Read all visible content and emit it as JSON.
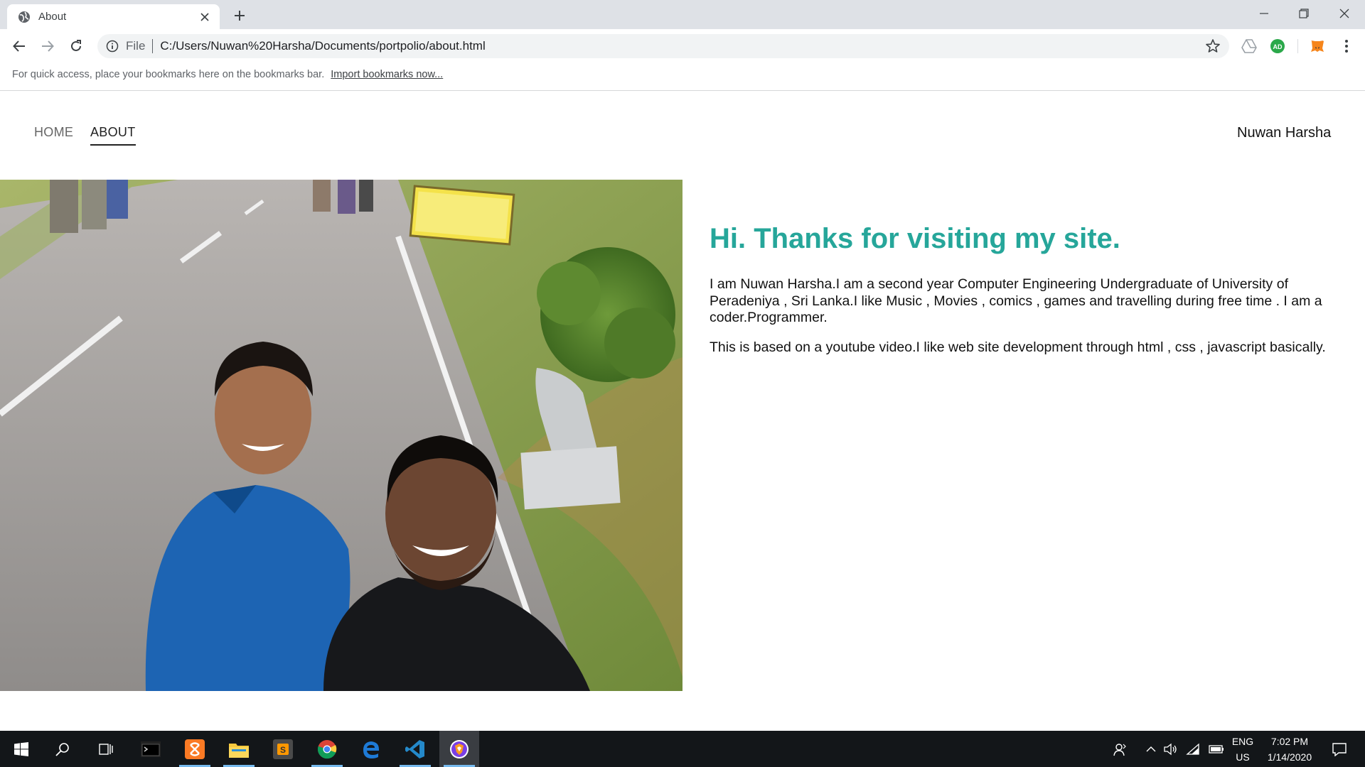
{
  "browser": {
    "tab_title": "About",
    "address": {
      "scheme_label": "File",
      "url": "C:/Users/Nuwan%20Harsha/Documents/portpolio/about.html"
    },
    "extensions": [
      "AD"
    ],
    "bookmarks_bar": {
      "message": "For quick access, place your bookmarks here on the bookmarks bar.",
      "link": "Import bookmarks now..."
    }
  },
  "page": {
    "nav": {
      "items": [
        "HOME",
        "ABOUT"
      ],
      "active": "ABOUT",
      "brand": "Nuwan Harsha"
    },
    "headline": "Hi. Thanks for visiting my site.",
    "paragraphs": [
      "I am Nuwan Harsha.I am a second year Computer Engineering Undergraduate of University of Peradeniya , Sri Lanka.I like Music , Movies , comics , games and travelling during free time . I am a coder.Programmer.",
      "This is based on a youtube video.I like web site development through html , css , javascript basically."
    ],
    "colors": {
      "accent": "#26a69a"
    }
  },
  "taskbar": {
    "apps": [
      "start-icon",
      "search-icon",
      "task-view-icon",
      "terminal-icon",
      "xampp-icon",
      "file-explorer-icon",
      "sublime-text-icon",
      "chrome-icon",
      "edge-icon",
      "vscode-icon",
      "brave-icon"
    ],
    "language": "ENG",
    "region": "US",
    "time": "7:02 PM",
    "date": "1/14/2020"
  }
}
